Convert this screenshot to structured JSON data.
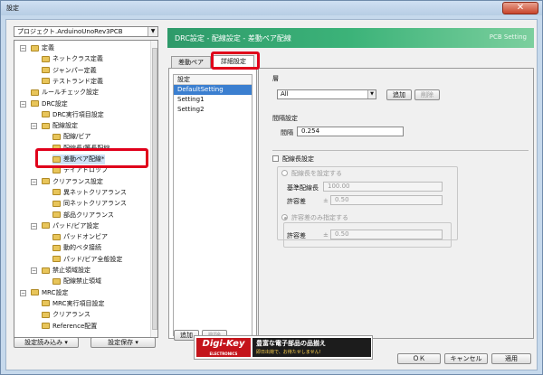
{
  "window": {
    "title": "設定",
    "close_glyph": "✕"
  },
  "project_select": {
    "value": "プロジェクト.ArduinoUnoRev3PCB"
  },
  "tree": {
    "nodes": [
      {
        "label": "定義",
        "level": 0,
        "expander": "⊟"
      },
      {
        "label": "ネットクラス定義",
        "level": 1
      },
      {
        "label": "ジャンパー定義",
        "level": 1
      },
      {
        "label": "テストランド定義",
        "level": 1
      },
      {
        "label": "ルールチェック設定",
        "level": 0
      },
      {
        "label": "DRC設定",
        "level": 0,
        "expander": "⊟"
      },
      {
        "label": "DRC実行項目設定",
        "level": 1
      },
      {
        "label": "配線設定",
        "level": 1,
        "expander": "⊟"
      },
      {
        "label": "配線/ビア",
        "level": 2
      },
      {
        "label": "配線長/等長配線",
        "level": 2
      },
      {
        "label": "差動ペア配線*",
        "level": 2
      },
      {
        "label": "テイアドロップ",
        "level": 2
      },
      {
        "label": "クリアランス設定",
        "level": 1,
        "expander": "⊟"
      },
      {
        "label": "異ネットクリアランス",
        "level": 2
      },
      {
        "label": "同ネットクリアランス",
        "level": 2
      },
      {
        "label": "部品クリアランス",
        "level": 2
      },
      {
        "label": "パッド/ビア設定",
        "level": 1,
        "expander": "⊟"
      },
      {
        "label": "パッドオンビア",
        "level": 2
      },
      {
        "label": "動的ベタ接続",
        "level": 2
      },
      {
        "label": "パッド/ビア全般設定",
        "level": 2
      },
      {
        "label": "禁止領域設定",
        "level": 1,
        "expander": "⊟"
      },
      {
        "label": "配線禁止領域",
        "level": 2
      },
      {
        "label": "MRC設定",
        "level": 0,
        "expander": "⊟"
      },
      {
        "label": "MRC実行項目設定",
        "level": 1
      },
      {
        "label": "クリアランス",
        "level": 1
      },
      {
        "label": "Reference配置",
        "level": 1
      }
    ]
  },
  "left_buttons": {
    "load": "設定読み込み ▾",
    "save": "設定保存 ▾"
  },
  "banner": {
    "title": "DRC設定 - 配線設定 - 差動ペア配線",
    "right": "PCB Setting"
  },
  "tabs": {
    "pair": "差動ペア",
    "detail": "詳細設定"
  },
  "settings_list": {
    "header": "設定",
    "items": [
      "DefaultSetting",
      "Setting1",
      "Setting2"
    ],
    "add": "追加",
    "delete": "削除"
  },
  "detail": {
    "layer_label": "層",
    "layer_value": "All",
    "layer_add": "追加",
    "layer_delete": "削除",
    "gap_section": "間隔設定",
    "gap_label": "間隔",
    "gap_value": "0.254",
    "length_section": "配線長設定",
    "length_radio_label": "配線長を設定する",
    "base_length_label": "基準配線長",
    "base_length_value": "100.00",
    "tolerance_label": "許容差",
    "tolerance_prefix": "±",
    "tolerance_value": "0.50",
    "diff_radio_label": "許容差のみ指定する",
    "tolerance2_label": "許容差",
    "tolerance2_prefix": "±",
    "tolerance2_value": "0.50"
  },
  "ad": {
    "logo": "Digi-Key",
    "logo_sub": "ELECTRONICS",
    "line1": "豊富な電子部品の品揃え",
    "line2": "即日出荷で、お待たせしません!"
  },
  "footer": {
    "ok": "ＯＫ",
    "cancel": "キャンセル",
    "apply": "適用"
  }
}
